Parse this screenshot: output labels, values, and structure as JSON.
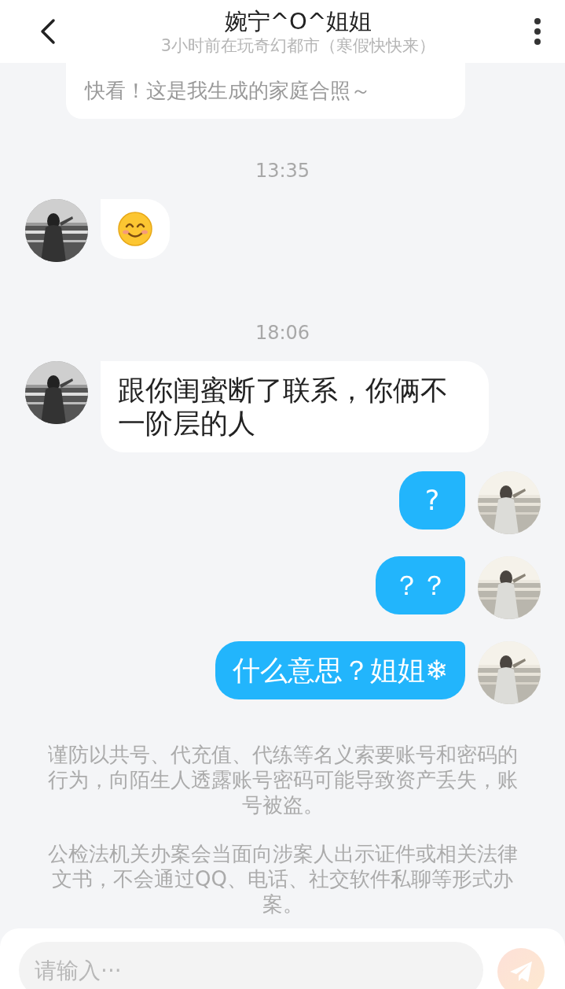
{
  "header": {
    "title": "婉宁^O^姐姐",
    "subtitle": "3小时前在玩奇幻都市（寒假快快来）"
  },
  "shared_card": {
    "text": "快看！这是我生成的家庭合照～"
  },
  "messages": [
    {
      "kind": "time",
      "text": "13:35"
    },
    {
      "kind": "emoji",
      "outgoing": false
    },
    {
      "kind": "time",
      "text": "18:06"
    },
    {
      "kind": "text",
      "outgoing": false,
      "text": "跟你闺蜜断了联系，你俩不一阶层的人"
    },
    {
      "kind": "text",
      "outgoing": true,
      "text": "?"
    },
    {
      "kind": "text",
      "outgoing": true,
      "text": "？？"
    },
    {
      "kind": "text",
      "outgoing": true,
      "text": "什么意思？姐姐❄"
    }
  ],
  "notices": [
    "谨防以共号、代充值、代练等名义索要账号和密码的行为，向陌生人透露账号密码可能导致资产丢失，账号被盗。",
    "公检法机关办案会当面向涉案人出示证件或相关法律文书，不会通过QQ、电话、社交软件私聊等形式办案。"
  ],
  "input": {
    "placeholder": "请输入···"
  }
}
